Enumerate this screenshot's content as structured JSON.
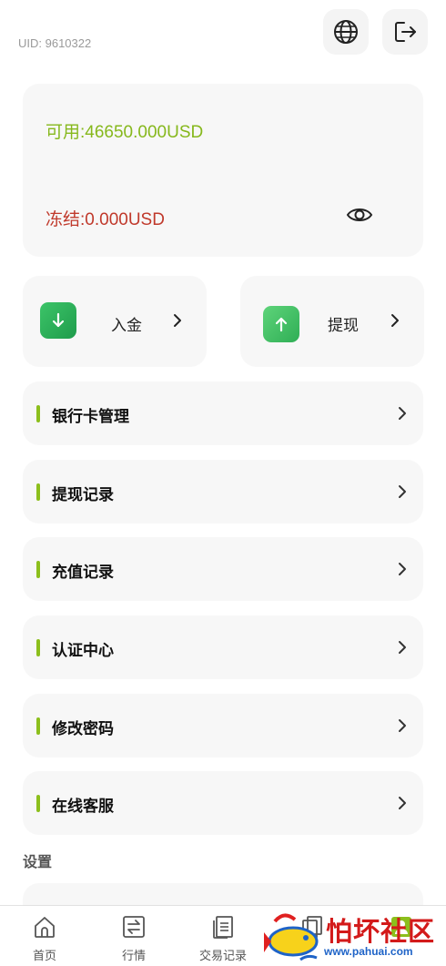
{
  "header": {
    "uid": "UID: 9610322",
    "globe_icon": "globe-icon",
    "logout_icon": "logout-icon"
  },
  "balance": {
    "available": "可用:46650.000USD",
    "frozen": "冻结:0.000USD",
    "available_color": "#86b81c",
    "frozen_color": "#c0392b",
    "eye_icon": "eye-icon"
  },
  "actions": {
    "deposit_label": "入金",
    "withdraw_label": "提现",
    "deposit_icon": "arrow-down-icon",
    "withdraw_icon": "arrow-up-icon"
  },
  "menu": [
    {
      "label": "银行卡管理"
    },
    {
      "label": "提现记录"
    },
    {
      "label": "充值记录"
    },
    {
      "label": "认证中心"
    },
    {
      "label": "修改密码"
    },
    {
      "label": "在线客服"
    }
  ],
  "settings": {
    "title": "设置"
  },
  "tabbar": [
    {
      "label": "首页",
      "icon": "home-icon"
    },
    {
      "label": "行情",
      "icon": "exchange-icon"
    },
    {
      "label": "交易记录",
      "icon": "document-icon"
    },
    {
      "label": "",
      "icon": "copy-icon"
    },
    {
      "label": "",
      "icon": "user-icon"
    }
  ],
  "accent_color": "#8cbf1c",
  "watermark": {
    "text": "怕坏社区",
    "url": "www.pahuai.com"
  }
}
